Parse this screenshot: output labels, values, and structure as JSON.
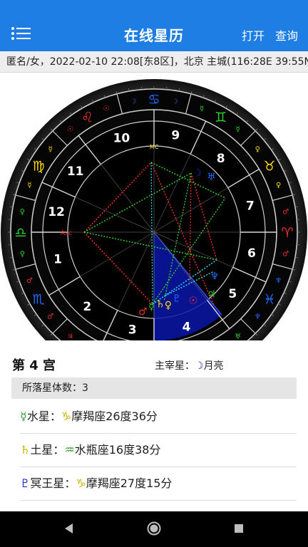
{
  "header": {
    "title": "在线星历",
    "menu_icon": "list-menu-icon",
    "open_label": "打开",
    "query_label": "查询",
    "color": "#1e7ee4"
  },
  "info": {
    "text": "匿名/女，2022-02-10 22:08[东8区]，北京 主城(116:28E 39:55N)"
  },
  "chart": {
    "house_numbers": [
      "1",
      "2",
      "3",
      "4",
      "5",
      "6",
      "7",
      "8",
      "9",
      "10",
      "11",
      "12"
    ],
    "mc_label": "MC",
    "asc_label": "Asc",
    "zodiac_glyphs": [
      "♈",
      "♉",
      "♊",
      "♋",
      "♌",
      "♍",
      "♎",
      "♏",
      "♐",
      "♑",
      "♒",
      "♓"
    ],
    "planet_glyphs": {
      "sun": "☉",
      "moon": "☽",
      "mercury": "☿",
      "venus": "♀",
      "mars": "♂",
      "jupiter": "♃",
      "saturn": "♄",
      "uranus": "♅",
      "neptune": "♆",
      "pluto": "♇"
    }
  },
  "detail": {
    "house_title": "第 4 宫",
    "ruler_label": "主宰星：",
    "ruler_symbol": "☽",
    "ruler_name": "月亮",
    "count_label": "所落星体数：",
    "count_value": "3",
    "planets": [
      {
        "symbol": "☿",
        "symbol_color": "#2f9e28",
        "name": "水星：",
        "sign_symbol": "♑",
        "sign_color": "#c9b400",
        "sign_text": "摩羯座26度36分"
      },
      {
        "symbol": "♄",
        "symbol_color": "#c9b400",
        "name": "土星：",
        "sign_symbol": "♒",
        "sign_color": "#2f9e28",
        "sign_text": "水瓶座16度38分"
      },
      {
        "symbol": "♇",
        "symbol_color": "#1d2bd0",
        "name": "冥王星：",
        "sign_symbol": "♑",
        "sign_color": "#c9b400",
        "sign_text": "摩羯座27度15分"
      }
    ]
  },
  "navbar": {
    "back_icon": "back-triangle-icon",
    "home_icon": "home-circle-icon",
    "recents_icon": "recents-square-icon"
  }
}
